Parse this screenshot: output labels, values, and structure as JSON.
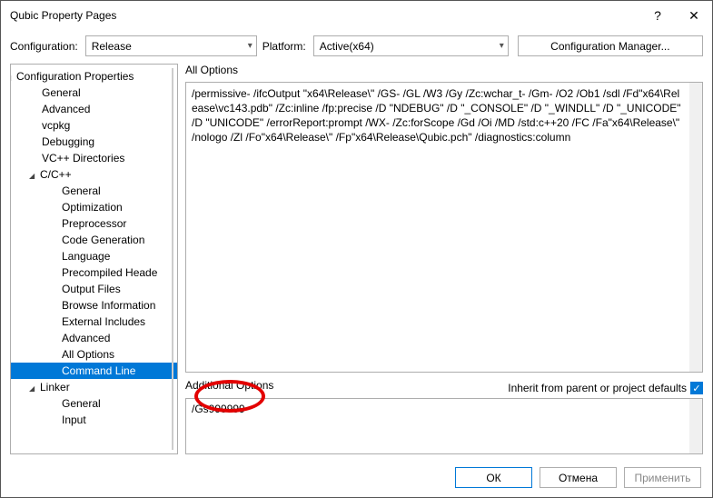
{
  "titlebar": {
    "title": "Qubic Property Pages"
  },
  "toprow": {
    "config_label": "Configuration:",
    "config_value": "Release",
    "platform_label": "Platform:",
    "platform_value": "Active(x64)",
    "cfg_mgr": "Configuration Manager..."
  },
  "tree": {
    "root": "Configuration Properties",
    "items": [
      "General",
      "Advanced",
      "vcpkg",
      "Debugging",
      "VC++ Directories"
    ],
    "cc": "C/C++",
    "cc_items": [
      "General",
      "Optimization",
      "Preprocessor",
      "Code Generation",
      "Language",
      "Precompiled Heade",
      "Output Files",
      "Browse Information",
      "External Includes",
      "Advanced",
      "All Options",
      "Command Line"
    ],
    "linker": "Linker",
    "linker_items": [
      "General",
      "Input"
    ]
  },
  "right": {
    "all_options_label": "All Options",
    "all_options_text": "/permissive- /ifcOutput \"x64\\Release\\\" /GS- /GL /W3 /Gy /Zc:wchar_t- /Gm- /O2 /Ob1 /sdl /Fd\"x64\\Release\\vc143.pdb\" /Zc:inline /fp:precise /D \"NDEBUG\" /D \"_CONSOLE\" /D \"_WINDLL\" /D \"_UNICODE\" /D \"UNICODE\" /errorReport:prompt /WX- /Zc:forScope /Gd /Oi /MD /std:c++20 /FC /Fa\"x64\\Release\\\" /nologo /Zl /Fo\"x64\\Release\\\" /Fp\"x64\\Release\\Qubic.pch\" /diagnostics:column",
    "additional_label": "Additional Options",
    "inherit_label": "Inherit from parent or project defaults",
    "additional_text": "/Gs999999"
  },
  "footer": {
    "ok": "ОК",
    "cancel": "Отмена",
    "apply": "Применить"
  }
}
